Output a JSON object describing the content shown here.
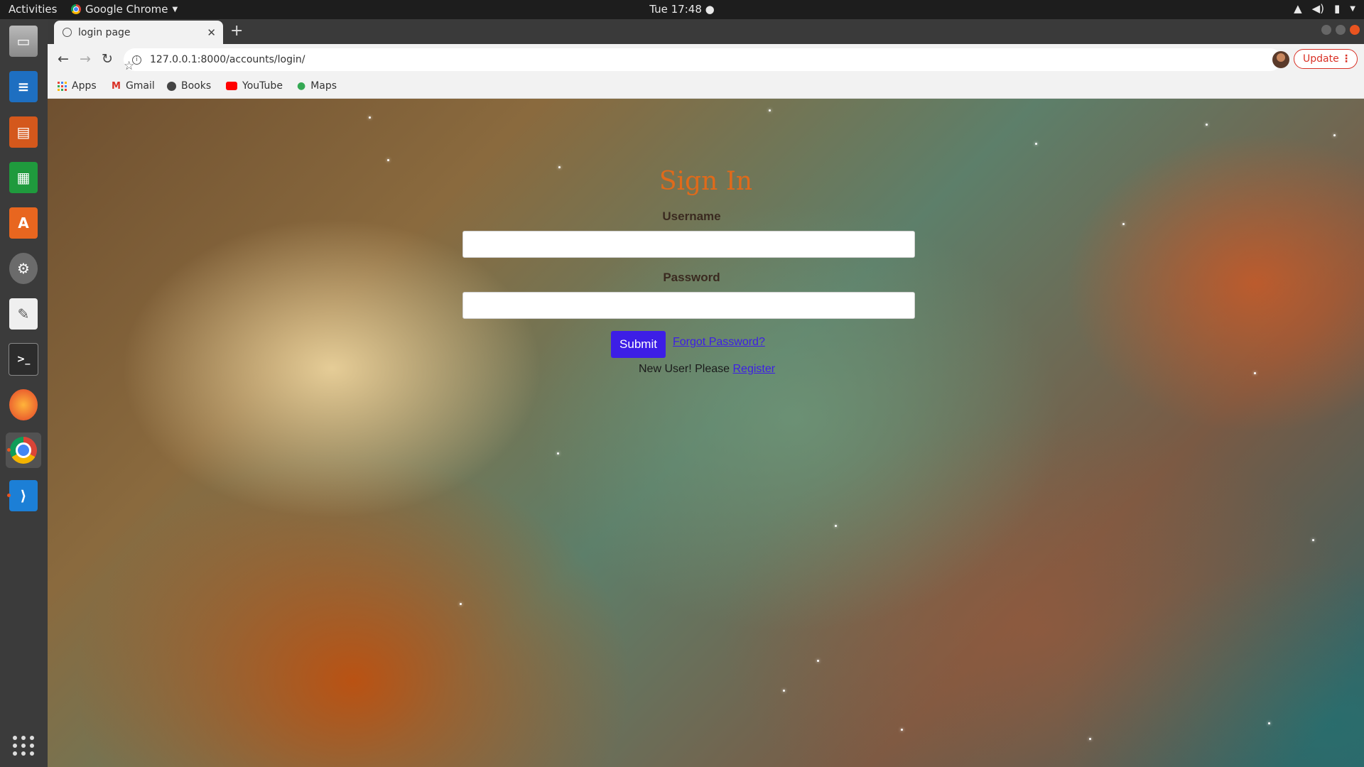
{
  "topbar": {
    "activities": "Activities",
    "app_name": "Google Chrome",
    "clock": "Tue 17:48"
  },
  "dock": {
    "items": [
      "files-icon",
      "writer-icon",
      "impress-icon",
      "calc-icon",
      "software-center-icon",
      "settings-icon",
      "text-editor-icon",
      "terminal-icon",
      "firefox-icon",
      "chrome-icon",
      "vscode-icon"
    ],
    "show_apps": "show-apps-icon"
  },
  "browser": {
    "tab_title": "login page",
    "url": "127.0.0.1:8000/accounts/login/",
    "update_label": "Update",
    "bookmarks": [
      "Apps",
      "Gmail",
      "Books",
      "YouTube",
      "Maps"
    ]
  },
  "login": {
    "title": "Sign In",
    "username_label": "Username",
    "username_value": "",
    "password_label": "Password",
    "password_value": "",
    "submit_label": "Submit",
    "forgot_label": "Forgot Password?",
    "new_user_text": "New User! Please ",
    "register_label": "Register"
  },
  "colors": {
    "accent_button": "#3d1ee6",
    "title_color": "#e06a1a",
    "update_red": "#d93025"
  }
}
